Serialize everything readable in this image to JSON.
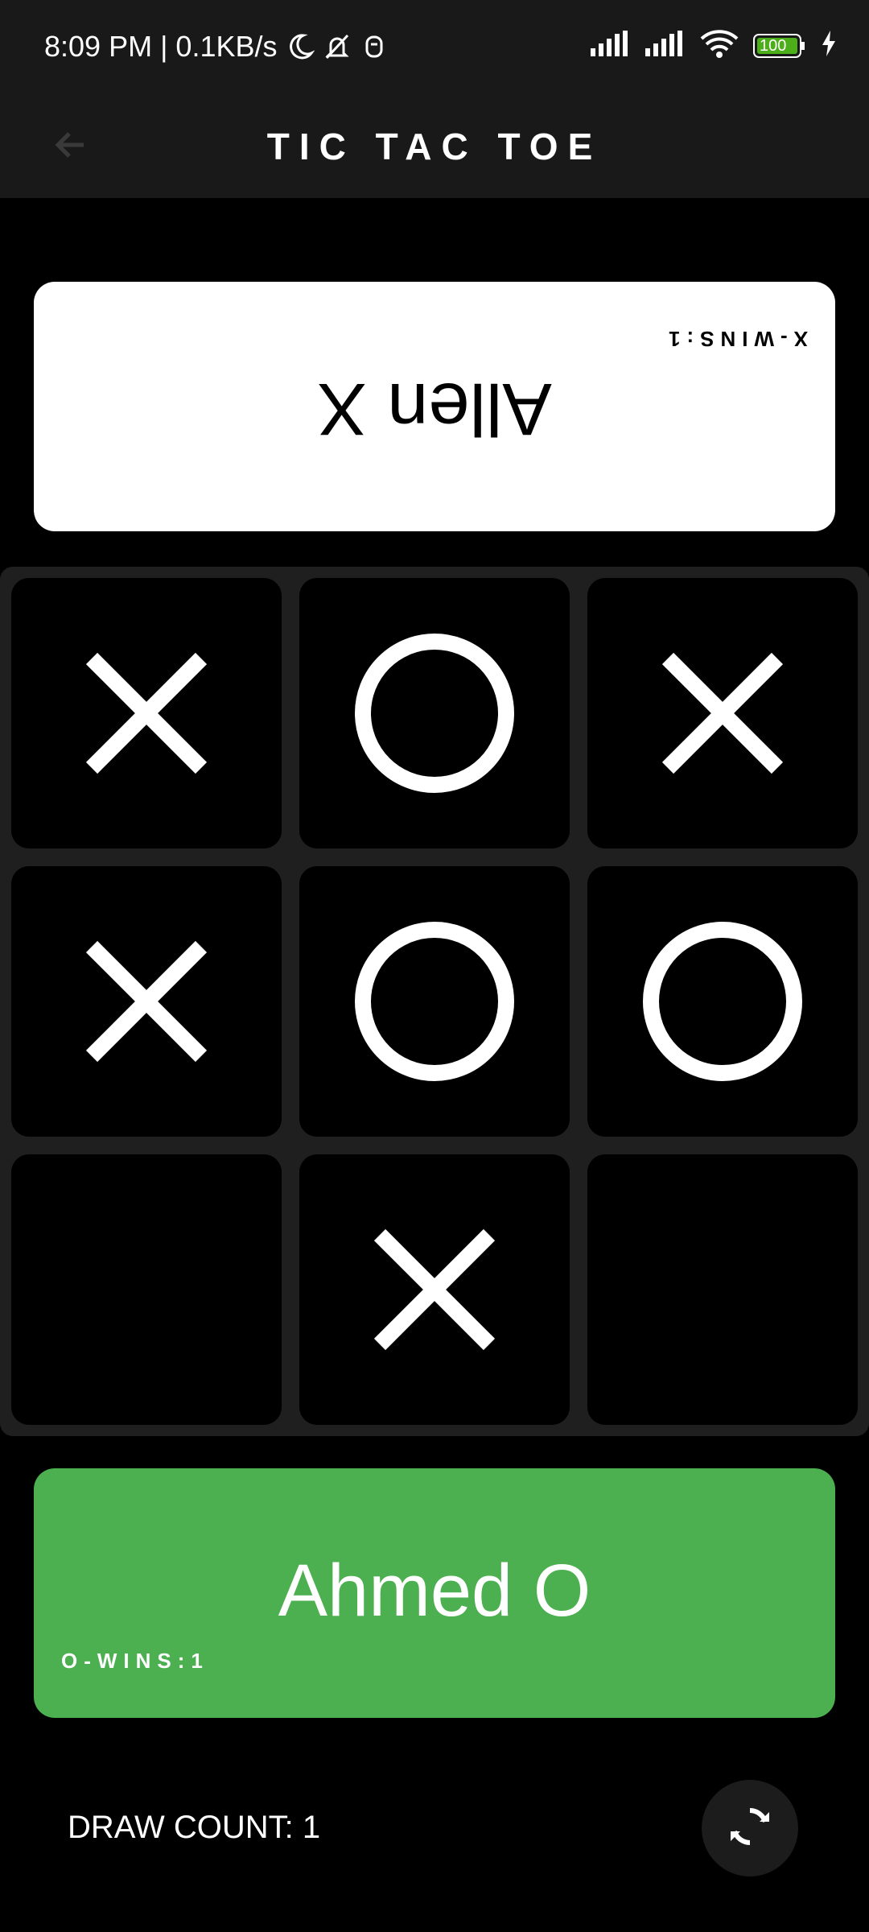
{
  "status_bar": {
    "time_network": "8:09 PM | 0.1KB/s",
    "battery": "100"
  },
  "app_bar": {
    "title": "TIC TAC TOE",
    "back_icon": "arrow-back-icon"
  },
  "player_x": {
    "name": "Allen X",
    "wins_label": "X-WINS:1",
    "card_color": "#ffffff"
  },
  "player_o": {
    "name": "Ahmed O",
    "wins_label": "O-WINS:1",
    "card_color": "#4CAF50"
  },
  "board": {
    "cells": [
      [
        "X",
        "O",
        "X"
      ],
      [
        "X",
        "O",
        "O"
      ],
      [
        "",
        "X",
        ""
      ]
    ]
  },
  "footer": {
    "draw_count": "DRAW COUNT: 1",
    "reset_icon": "refresh-icon"
  }
}
